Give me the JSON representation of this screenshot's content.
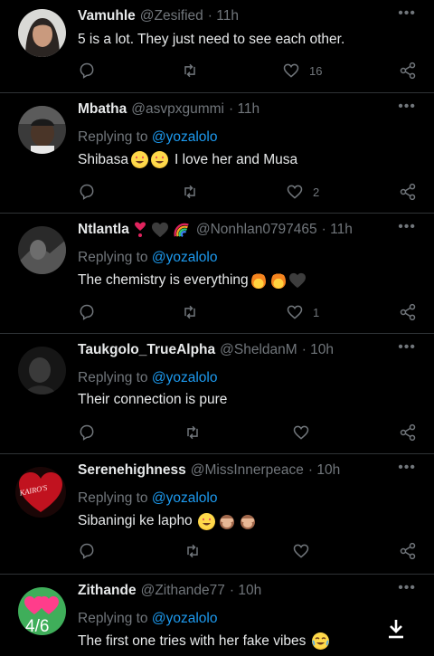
{
  "tweets": [
    {
      "name": "Vamuhle",
      "handle": "@Zesified",
      "time": "· 11h",
      "text": "5 is a lot. They just  need to see each other.",
      "likes": "16"
    },
    {
      "name": "Mbatha",
      "handle": "@asvpxgummi",
      "time": "· 11h",
      "replying_prefix": "Replying to",
      "replying_to": "@yozalolo",
      "text_before": "Shibasa",
      "text_after": "I love her and Musa",
      "likes": "2"
    },
    {
      "name": "Ntlantla",
      "handle": "@Nonhlan0797465",
      "time": "· 11h",
      "replying_prefix": "Replying to",
      "replying_to": "@yozalolo",
      "text": "The chemistry is everything",
      "likes": "1"
    },
    {
      "name": "Taukgolo_TrueAlpha",
      "handle": "@SheldanM",
      "time": "· 10h",
      "replying_prefix": "Replying to",
      "replying_to": "@yozalolo",
      "text": "Their connection is pure"
    },
    {
      "name": "Serenehighness",
      "handle": "@MissInnerpeace",
      "time": "· 10h",
      "replying_prefix": "Replying to",
      "replying_to": "@yozalolo",
      "text": "Sibaningi ke lapho",
      "avatar_text": "KAIRO'S"
    },
    {
      "name": "Zithande",
      "handle": "@Zithande77",
      "time": "· 10h",
      "replying_prefix": "Replying to",
      "replying_to": "@yozalolo",
      "text": "The first one tries with her fake vibes"
    }
  ],
  "viewer": {
    "page_indicator": "4/6"
  },
  "colors": {
    "background": "#000000",
    "muted": "#71767b",
    "link": "#1d9bf0",
    "text": "#e7e9ea"
  }
}
